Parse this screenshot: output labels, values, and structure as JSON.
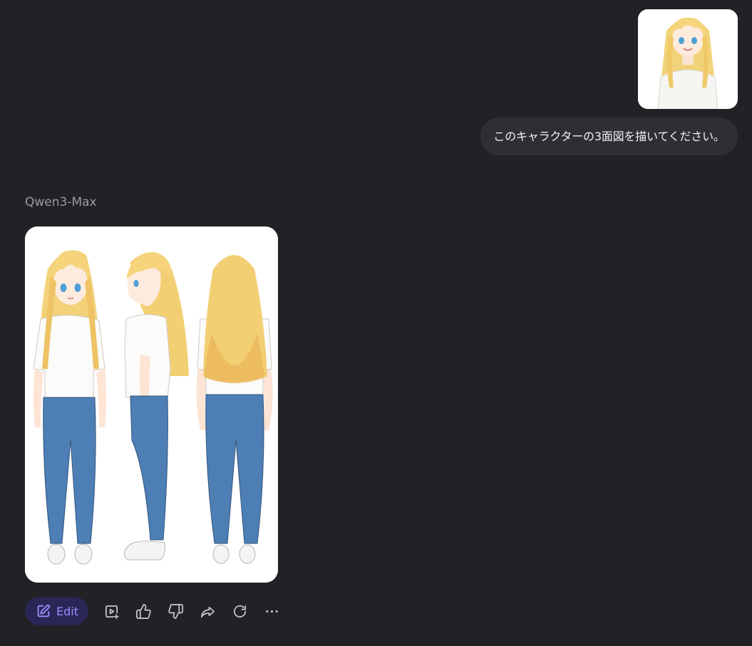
{
  "user_message": {
    "image_alt": "Blonde anime girl in white T-shirt",
    "text": "このキャラクターの3面図を描いてください。"
  },
  "assistant": {
    "model_name": "Qwen3-Max",
    "image_alt": "Three-view character sheet: front, side, back",
    "actions": {
      "edit_label": "Edit",
      "icons": [
        "video-generate-icon",
        "thumbs-up-icon",
        "thumbs-down-icon",
        "share-icon",
        "regenerate-icon",
        "more-icon"
      ]
    }
  },
  "colors": {
    "background": "#222226",
    "bubble": "#2e2e33",
    "accent": "#9c8cff",
    "edit_bg": "#2a2656",
    "icon": "#c8c8cf"
  }
}
